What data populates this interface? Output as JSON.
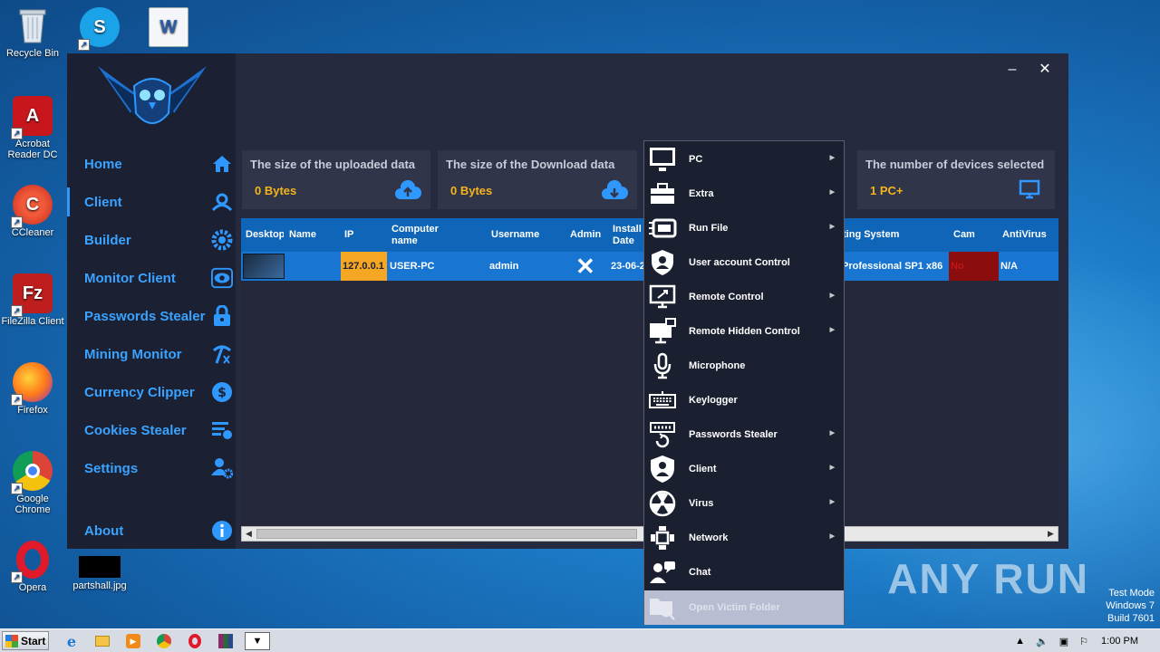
{
  "desktop": {
    "icons": [
      {
        "label": "Recycle Bin"
      },
      {
        "label": ""
      },
      {
        "label": ""
      },
      {
        "label": "Acrobat Reader DC"
      },
      {
        "label": "CCleaner"
      },
      {
        "label": "FileZilla Client"
      },
      {
        "label": "Firefox"
      },
      {
        "label": "Google Chrome"
      },
      {
        "label": "Opera"
      },
      {
        "label": "partshall.jpg"
      }
    ],
    "watermark": "ANY RUN",
    "test_mode": {
      "line1": "Test Mode",
      "line2": "Windows 7",
      "line3": "Build 7601"
    }
  },
  "app": {
    "window_controls": {
      "minimize": "–",
      "close": "✕"
    },
    "nav": [
      {
        "label": "Home",
        "icon": "home-icon"
      },
      {
        "label": "Client",
        "icon": "user-icon"
      },
      {
        "label": "Builder",
        "icon": "gear-icon"
      },
      {
        "label": "Monitor Client",
        "icon": "eye-icon"
      },
      {
        "label": "Passwords Stealer",
        "icon": "lock-icon"
      },
      {
        "label": "Mining Monitor",
        "icon": "pickaxe-icon"
      },
      {
        "label": "Currency Clipper",
        "icon": "coin-icon"
      },
      {
        "label": "Cookies Stealer",
        "icon": "list-icon"
      },
      {
        "label": "Settings",
        "icon": "user-gear-icon"
      },
      {
        "label": "About",
        "icon": "info-icon"
      }
    ],
    "cards": [
      {
        "title": "The size of the uploaded data",
        "value": "0 Bytes",
        "icon": "cloud-upload-icon"
      },
      {
        "title": "The size of the Download data",
        "value": "0 Bytes",
        "icon": "cloud-download-icon"
      },
      {
        "title": "The number of devices selected",
        "value": "1 PC+",
        "icon": "monitor-icon"
      }
    ],
    "grid": {
      "columns": [
        "Desktop",
        "Name",
        "IP",
        "Computer name",
        "Username",
        "Admin",
        "Install Date",
        "ting System",
        "Cam",
        "AntiVirus"
      ],
      "row": {
        "desktop": "",
        "name": "",
        "ip": "127.0.0.1",
        "computer_name": "USER-PC",
        "username": "admin",
        "admin": "✕",
        "install_date": "23-06-2",
        "os": "Professional SP1 x86",
        "cam": "No",
        "antivirus": "N/A"
      }
    }
  },
  "context_menu": {
    "items": [
      {
        "label": "PC",
        "icon": "pc-icon",
        "submenu": true
      },
      {
        "label": "Extra",
        "icon": "toolbox-icon",
        "submenu": true
      },
      {
        "label": "Run File",
        "icon": "run-file-icon",
        "submenu": true
      },
      {
        "label": "User account Control",
        "icon": "shield-user-icon",
        "submenu": false
      },
      {
        "label": "Remote Control",
        "icon": "remote-control-icon",
        "submenu": true
      },
      {
        "label": "Remote Hidden Control",
        "icon": "hidden-control-icon",
        "submenu": true
      },
      {
        "label": "Microphone",
        "icon": "microphone-icon",
        "submenu": false
      },
      {
        "label": "Keylogger",
        "icon": "keyboard-icon",
        "submenu": false
      },
      {
        "label": "Passwords Stealer",
        "icon": "password-icon",
        "submenu": true
      },
      {
        "label": "Client",
        "icon": "client-shield-icon",
        "submenu": true
      },
      {
        "label": "Virus",
        "icon": "radiation-icon",
        "submenu": true
      },
      {
        "label": "Network",
        "icon": "network-icon",
        "submenu": true
      },
      {
        "label": "Chat",
        "icon": "chat-icon",
        "submenu": false
      },
      {
        "label": "Open Victim Folder",
        "icon": "folder-search-icon",
        "submenu": false,
        "disabled": true
      }
    ]
  },
  "taskbar": {
    "start_label": "Start",
    "clock": "1:00 PM"
  }
}
